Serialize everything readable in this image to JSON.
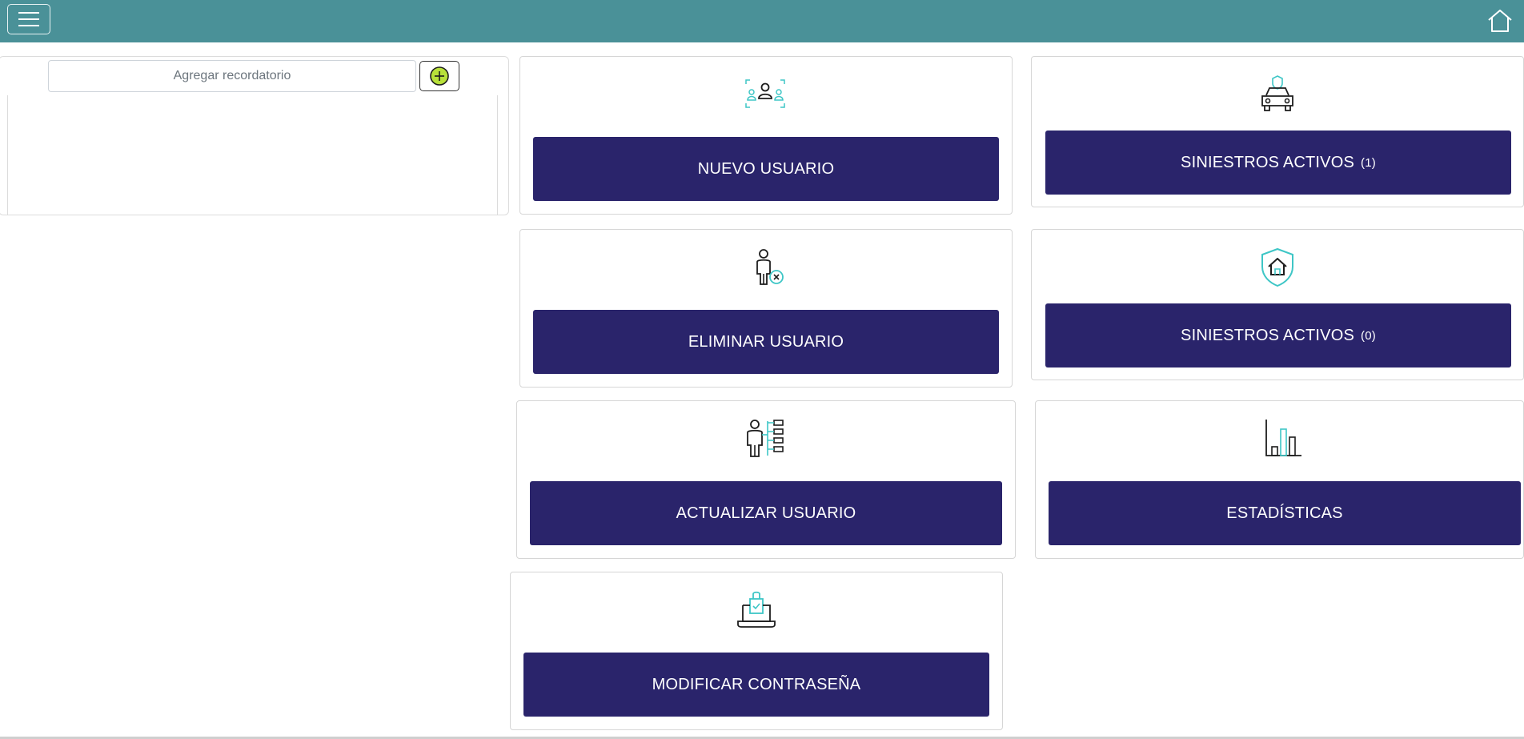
{
  "header": {
    "menu_icon": "hamburger-menu-icon",
    "home_icon": "home-icon",
    "background": "#4a9198"
  },
  "reminder": {
    "placeholder": "Agregar recordatorio",
    "add_icon": "plus-circle-icon",
    "add_icon_color": "#b8e13a"
  },
  "cards": {
    "nuevo_usuario": {
      "label": "NUEVO USUARIO",
      "icon": "users-group-icon"
    },
    "siniestros_auto": {
      "label": "SINIESTROS ACTIVOS",
      "count": "(1)",
      "icon": "car-insurance-icon"
    },
    "eliminar_usuario": {
      "label": "ELIMINAR USUARIO",
      "icon": "remove-user-icon"
    },
    "siniestros_hogar": {
      "label": "SINIESTROS ACTIVOS",
      "count": "(0)",
      "icon": "home-shield-icon"
    },
    "actualizar_usuario": {
      "label": "ACTUALIZAR USUARIO",
      "icon": "user-update-list-icon"
    },
    "estadisticas": {
      "label": "ESTADÍSTICAS",
      "icon": "bar-chart-icon"
    },
    "modificar_contrasena": {
      "label": "MODIFICAR CONTRASEÑA",
      "icon": "laptop-lock-icon"
    }
  },
  "colors": {
    "button_bg": "#2a246b",
    "accent": "#3ec6c6"
  }
}
